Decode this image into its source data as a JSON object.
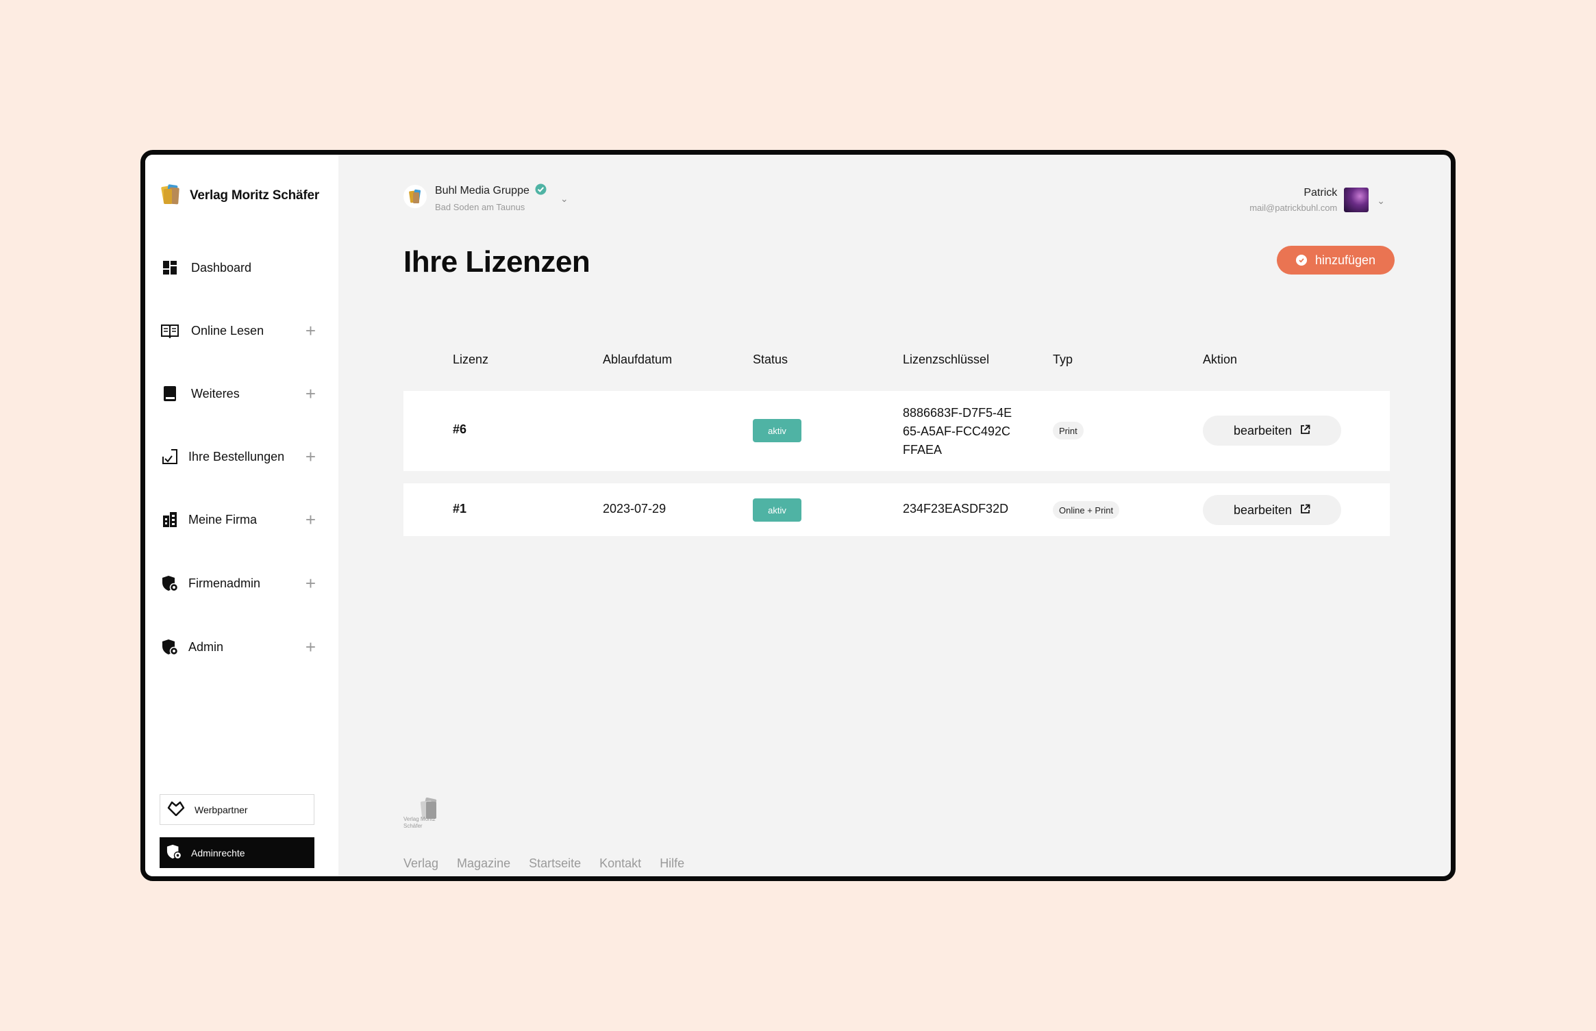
{
  "brand": {
    "name": "Verlag Moritz Schäfer",
    "logo_icon": "books-logo-icon"
  },
  "sidebar": {
    "items": [
      {
        "label": "Dashboard",
        "icon": "dashboard-icon",
        "expandable": false
      },
      {
        "label": "Online Lesen",
        "icon": "open-book-icon",
        "expandable": true
      },
      {
        "label": "Weiteres",
        "icon": "book-icon",
        "expandable": true
      },
      {
        "label": "Ihre Bestellungen",
        "icon": "checkbox-icon",
        "expandable": true
      },
      {
        "label": "Meine Firma",
        "icon": "building-icon",
        "expandable": true
      },
      {
        "label": "Firmenadmin",
        "icon": "shield-icon",
        "expandable": true
      },
      {
        "label": "Admin",
        "icon": "shield-icon",
        "expandable": true
      }
    ],
    "plus": "+",
    "werbpartner_label": "Werbpartner",
    "adminrechte_label": "Adminrechte"
  },
  "org": {
    "name": "Buhl Media Gruppe",
    "location": "Bad Soden am Taunus",
    "verified_icon": "verified-check-icon"
  },
  "user": {
    "name": "Patrick",
    "email": "mail@patrickbuhl.com"
  },
  "page": {
    "title": "Ihre Lizenzen",
    "add_label": "hinzufügen"
  },
  "table": {
    "columns": [
      "Lizenz",
      "Ablaufdatum",
      "Status",
      "Lizenzschlüssel",
      "Typ",
      "Aktion"
    ],
    "rows": [
      {
        "license": "#6",
        "expires": "",
        "status": "aktiv",
        "key": "8886683F-D7F5-4E65-A5AF-FCC492CFFAEA",
        "type": "Print",
        "action": "bearbeiten"
      },
      {
        "license": "#1",
        "expires": "2023-07-29",
        "status": "aktiv",
        "key": "234F23EASDF32D",
        "type": "Online + Print",
        "action": "bearbeiten"
      }
    ]
  },
  "footer": {
    "logo_text": "Verlag Moritz Schäfer",
    "links": [
      "Verlag",
      "Magazine",
      "Startseite",
      "Kontakt",
      "Hilfe"
    ]
  },
  "colors": {
    "accent": "#ea7452",
    "status_active": "#4fb3a4",
    "background": "#fdece2"
  }
}
